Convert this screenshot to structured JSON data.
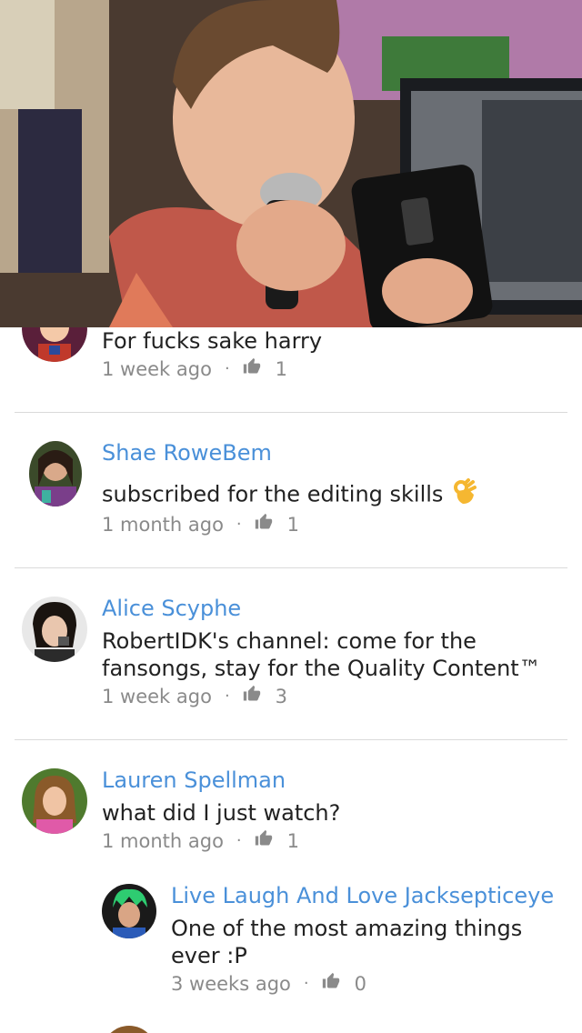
{
  "comments": [
    {
      "text": "For fucks sake harry",
      "time": "1 week ago",
      "likes": "1"
    },
    {
      "author": "Shae RoweBem",
      "text": "subscribed for the editing skills",
      "emoji_icon": "ok-hand-icon",
      "time": "1 month ago",
      "likes": "1"
    },
    {
      "author": "Alice Scyphe",
      "text": "RobertIDK's channel: come for the fansongs, stay for the Quality Content™",
      "time": "1 week ago",
      "likes": "3"
    },
    {
      "author": "Lauren Spellman",
      "text": "what did I just watch?",
      "time": "1 month ago",
      "likes": "1"
    },
    {
      "author": "Live Laugh And Love Jacksepticeye",
      "text": "One of the most amazing things ever :P",
      "time": "3 weeks ago",
      "likes": "0",
      "reply": true
    }
  ],
  "meta_separator": "·",
  "icons": {
    "like": "thumbs-up-icon"
  },
  "colors": {
    "author": "#4a90d9",
    "text": "#222222",
    "meta": "#8a8a8a",
    "divider": "#dadada"
  }
}
